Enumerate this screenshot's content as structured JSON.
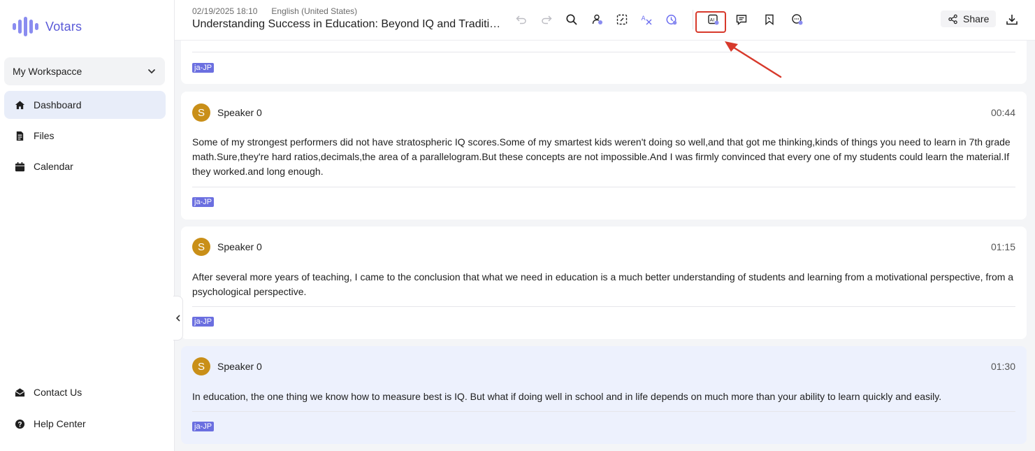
{
  "app": {
    "name": "Votars",
    "brand_color": "#5a5ad8"
  },
  "sidebar": {
    "workspace": "My Workspacce",
    "items": [
      {
        "label": "Dashboard",
        "icon": "home-icon",
        "active": true
      },
      {
        "label": "Files",
        "icon": "file-icon",
        "active": false
      },
      {
        "label": "Calendar",
        "icon": "calendar-icon",
        "active": false
      }
    ],
    "bottom": [
      {
        "label": "Contact Us",
        "icon": "mail-icon"
      },
      {
        "label": "Help Center",
        "icon": "help-icon"
      }
    ]
  },
  "header": {
    "date": "02/19/2025 18:10",
    "language": "English (United States)",
    "title": "Understanding Success in Education: Beyond IQ and Traditional Measures",
    "share_label": "Share",
    "tools": [
      "undo-icon",
      "redo-icon",
      "search-icon",
      "speaker-edit-icon",
      "select-icon",
      "translate-icon",
      "timer-icon",
      "ai-summary-icon",
      "comment-icon",
      "bookmark-icon",
      "chat-icon"
    ],
    "highlighted_tool": "ai-summary-icon"
  },
  "transcript": {
    "top_tag": "ja-JP",
    "segments": [
      {
        "speaker": "Speaker 0",
        "initial": "S",
        "time": "00:44",
        "text": "Some of my strongest performers did not have stratospheric IQ scores.Some of my smartest kids weren't doing so well,and that got me thinking,kinds of things you need to learn in 7th grade math.Sure,they're hard ratios,decimals,the area of a parallelogram.But these concepts are not impossible.And I was firmly convinced that every one of my students could learn the material.If they worked.and long enough.",
        "tag": "ja-JP"
      },
      {
        "speaker": "Speaker 0",
        "initial": "S",
        "time": "01:15",
        "text": "After several more years of teaching, I came to the conclusion that what we need in education is a much better understanding of students and learning from a motivational perspective, from a psychological perspective.",
        "tag": "ja-JP"
      },
      {
        "speaker": "Speaker 0",
        "initial": "S",
        "time": "01:30",
        "text": "In education, the one thing we know how to measure best is IQ. But what if doing well in school and in life depends on much more than your ability to learn quickly and easily.",
        "tag": "ja-JP",
        "selected": true
      }
    ]
  }
}
